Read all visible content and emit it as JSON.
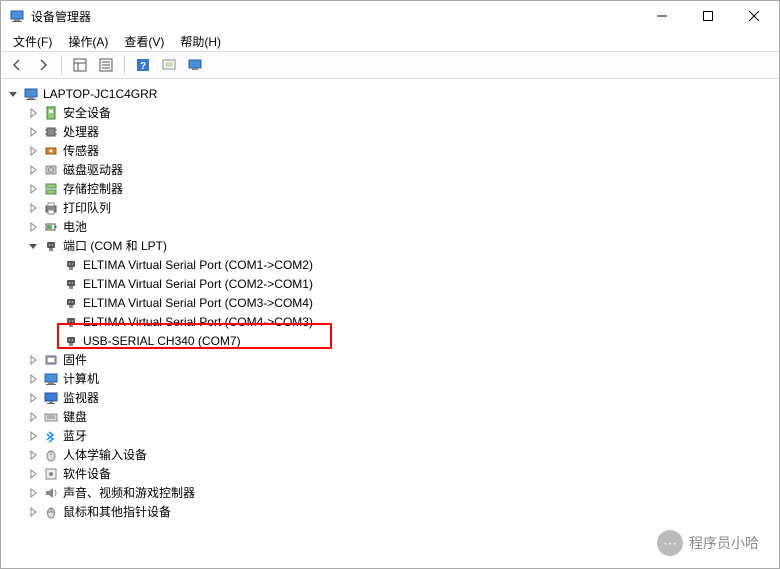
{
  "window": {
    "title": "设备管理器"
  },
  "menu": {
    "file": "文件(F)",
    "action": "操作(A)",
    "view": "查看(V)",
    "help": "帮助(H)"
  },
  "tree": {
    "root": "LAPTOP-JC1C4GRR",
    "nodes": [
      {
        "label": "安全设备",
        "icon": "security",
        "expanded": false,
        "depth": 1
      },
      {
        "label": "处理器",
        "icon": "cpu",
        "expanded": false,
        "depth": 1
      },
      {
        "label": "传感器",
        "icon": "sensor",
        "expanded": false,
        "depth": 1
      },
      {
        "label": "磁盘驱动器",
        "icon": "disk",
        "expanded": false,
        "depth": 1
      },
      {
        "label": "存储控制器",
        "icon": "storage",
        "expanded": false,
        "depth": 1
      },
      {
        "label": "打印队列",
        "icon": "printer",
        "expanded": false,
        "depth": 1
      },
      {
        "label": "电池",
        "icon": "battery",
        "expanded": false,
        "depth": 1
      },
      {
        "label": "端口 (COM 和 LPT)",
        "icon": "port",
        "expanded": true,
        "depth": 1
      },
      {
        "label": "ELTIMA Virtual Serial Port (COM1->COM2)",
        "icon": "port",
        "expanded": null,
        "depth": 2
      },
      {
        "label": "ELTIMA Virtual Serial Port (COM2->COM1)",
        "icon": "port",
        "expanded": null,
        "depth": 2
      },
      {
        "label": "ELTIMA Virtual Serial Port (COM3->COM4)",
        "icon": "port",
        "expanded": null,
        "depth": 2
      },
      {
        "label": "ELTIMA Virtual Serial Port (COM4->COM3)",
        "icon": "port",
        "expanded": null,
        "depth": 2
      },
      {
        "label": "USB-SERIAL CH340 (COM7)",
        "icon": "port",
        "expanded": null,
        "depth": 2,
        "highlight": true
      },
      {
        "label": "固件",
        "icon": "firmware",
        "expanded": false,
        "depth": 1
      },
      {
        "label": "计算机",
        "icon": "computer",
        "expanded": false,
        "depth": 1
      },
      {
        "label": "监视器",
        "icon": "monitor",
        "expanded": false,
        "depth": 1
      },
      {
        "label": "键盘",
        "icon": "keyboard",
        "expanded": false,
        "depth": 1
      },
      {
        "label": "蓝牙",
        "icon": "bluetooth",
        "expanded": false,
        "depth": 1
      },
      {
        "label": "人体学输入设备",
        "icon": "hid",
        "expanded": false,
        "depth": 1
      },
      {
        "label": "软件设备",
        "icon": "software",
        "expanded": false,
        "depth": 1
      },
      {
        "label": "声音、视频和游戏控制器",
        "icon": "sound",
        "expanded": false,
        "depth": 1
      },
      {
        "label": "鼠标和其他指针设备",
        "icon": "mouse",
        "expanded": false,
        "depth": 1
      }
    ]
  },
  "watermark": {
    "text": "程序员小哈"
  }
}
